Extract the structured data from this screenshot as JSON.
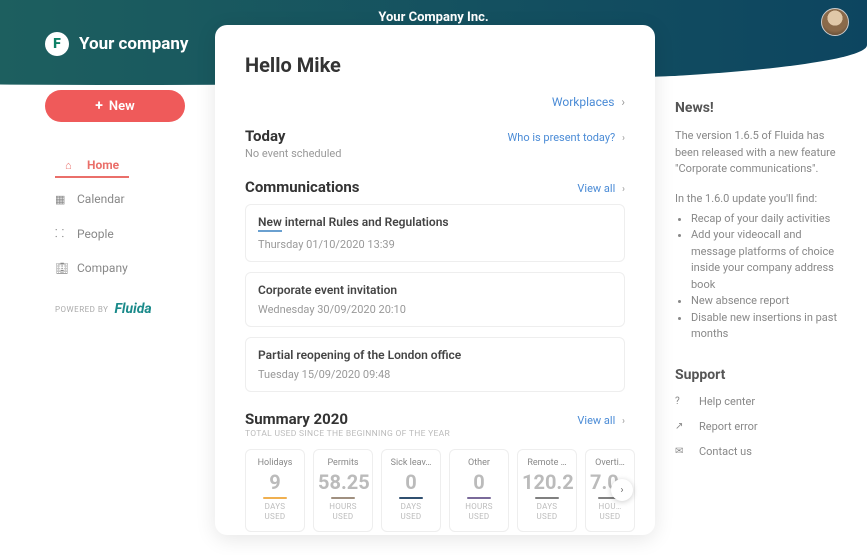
{
  "header": {
    "company_title": "Your Company Inc.",
    "logo_text": "Your company"
  },
  "sidebar": {
    "new_label": "New",
    "nav": [
      {
        "icon": "home-icon",
        "label": "Home",
        "active": true
      },
      {
        "icon": "calendar-icon",
        "label": "Calendar",
        "active": false
      },
      {
        "icon": "people-icon",
        "label": "People",
        "active": false
      },
      {
        "icon": "company-icon",
        "label": "Company",
        "active": false
      }
    ],
    "powered_by_label": "POWERED BY",
    "powered_by_brand": "Fluida"
  },
  "main": {
    "greeting": "Hello Mike",
    "workplaces_link": "Workplaces",
    "today": {
      "title": "Today",
      "link": "Who is present today?",
      "empty": "No event scheduled"
    },
    "communications": {
      "title": "Communications",
      "view_all": "View all",
      "items": [
        {
          "new_badge": "New",
          "title": "internal Rules and Regulations",
          "date": "Thursday 01/10/2020 13:39"
        },
        {
          "title": "Corporate event invitation",
          "date": "Wednesday 30/09/2020 20:10"
        },
        {
          "title": "Partial reopening of the London office",
          "date": "Tuesday 15/09/2020 09:48"
        }
      ]
    },
    "summary": {
      "title": "Summary 2020",
      "subtitle": "TOTAL USED SINCE THE BEGINNING OF THE YEAR",
      "view_all": "View all",
      "tiles": [
        {
          "label": "Holidays",
          "value": "9",
          "unit1": "DAYS",
          "unit2": "USED",
          "color": "#f0b050"
        },
        {
          "label": "Permits",
          "value": "58.25",
          "unit1": "HOURS",
          "unit2": "USED",
          "color": "#a09080"
        },
        {
          "label": "Sick leav…",
          "value": "0",
          "unit1": "DAYS",
          "unit2": "USED",
          "color": "#305070"
        },
        {
          "label": "Other",
          "value": "0",
          "unit1": "HOURS",
          "unit2": "USED",
          "color": "#7a6a9a"
        },
        {
          "label": "Remote …",
          "value": "120.2",
          "unit1": "DAYS",
          "unit2": "USED",
          "color": "#808080"
        },
        {
          "label": "Overti…",
          "value": "7.0…",
          "unit1": "HOU…",
          "unit2": "USED",
          "color": "#808080"
        }
      ]
    }
  },
  "right": {
    "news_title": "News!",
    "news_body": "The version 1.6.5 of Fluida has been released with a new feature \"Corporate communications\".",
    "news_intro": "In the 1.6.0 update you'll find:",
    "news_items": [
      "Recap of your daily activities",
      "Add your videocall and message platforms of choice inside your company address book",
      "New absence report",
      "Disable new insertions in past months"
    ],
    "support_title": "Support",
    "support_items": [
      {
        "icon": "help-icon",
        "label": "Help center"
      },
      {
        "icon": "report-icon",
        "label": "Report error"
      },
      {
        "icon": "contact-icon",
        "label": "Contact us"
      }
    ]
  }
}
